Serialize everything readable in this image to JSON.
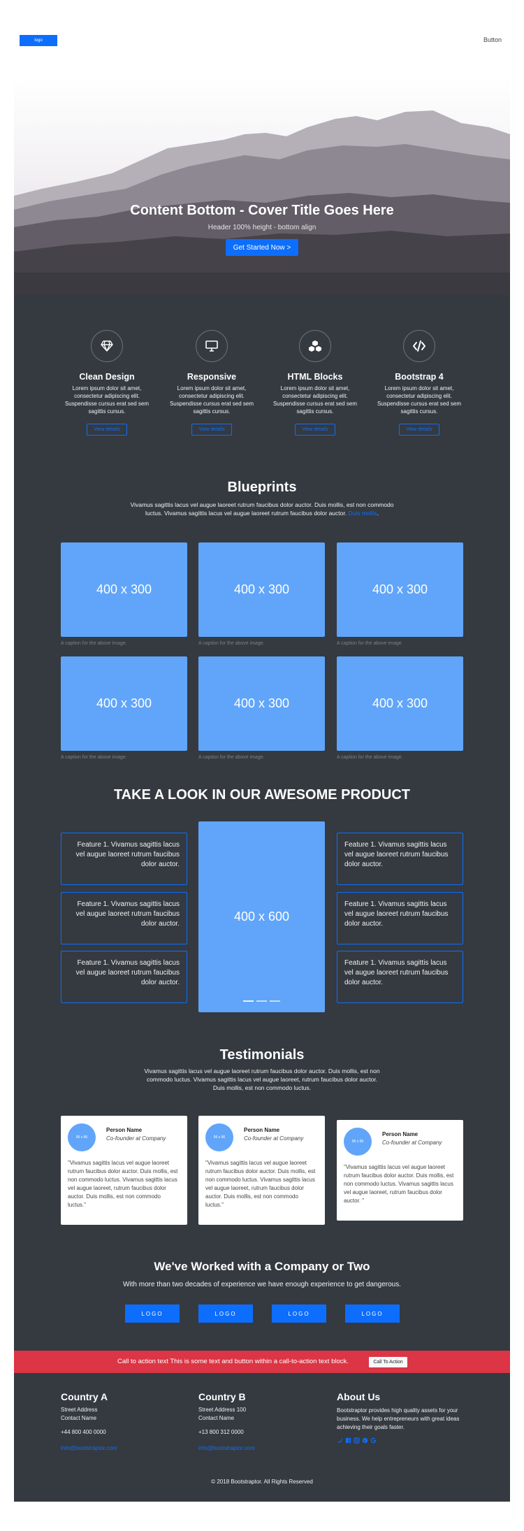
{
  "navbar": {
    "logo": "logo",
    "button": "Button"
  },
  "hero": {
    "title": "Content Bottom - Cover Title Goes Here",
    "subtitle": "Header 100% height - bottom align",
    "cta": "Get Started Now >"
  },
  "features": [
    {
      "icon": "diamond-icon",
      "title": "Clean Design",
      "text": "Lorem ipsum dolor sit amet, consectetur adipiscing elit. Suspendisse cursus erat sed sem sagittis cursus.",
      "button": "View details"
    },
    {
      "icon": "monitor-icon",
      "title": "Responsive",
      "text": "Lorem ipsum dolor sit amet, consectetur adipiscing elit. Suspendisse cursus erat sed sem sagittis cursus.",
      "button": "View details"
    },
    {
      "icon": "cubes-icon",
      "title": "HTML Blocks",
      "text": "Lorem ipsum dolor sit amet, consectetur adipiscing elit. Suspendisse cursus erat sed sem sagittis cursus.",
      "button": "View details"
    },
    {
      "icon": "code-icon",
      "title": "Bootstrap 4",
      "text": "Lorem ipsum dolor sit amet, consectetur adipiscing elit. Suspendisse cursus erat sed sem sagittis cursus.",
      "button": "View details"
    }
  ],
  "blueprints": {
    "title": "Blueprints",
    "text": "Vivamus sagittis lacus vel augue laoreet rutrum faucibus dolor auctor. Duis mollis, est non commodo luctus. Vivamus sagittis lacus vel augue laoreet rutrum faucibus dolor auctor.",
    "link": "Duis mollis",
    "images": [
      {
        "label": "400 x 300",
        "caption": "A caption for the above image."
      },
      {
        "label": "400 x 300",
        "caption": "A caption for the above image."
      },
      {
        "label": "400 x 300",
        "caption": "A caption for the above image."
      },
      {
        "label": "400 x 300",
        "caption": "A caption for the above image."
      },
      {
        "label": "400 x 300",
        "caption": "A caption for the above image."
      },
      {
        "label": "400 x 300",
        "caption": "A caption for the above image."
      }
    ]
  },
  "product": {
    "title": "TAKE A LOOK IN OUR AWESOME PRODUCT",
    "image_label": "400 x 600",
    "feature_text": "Feature 1. Vivamus sagittis lacus vel augue laoreet rutrum faucibus dolor auctor."
  },
  "testimonials": {
    "title": "Testimonials",
    "text": "Vivamus sagittis lacus vel augue laoreet rutrum faucibus dolor auctor. Duis mollis, est non commodo luctus. Vivamus sagittis lacus vel augue laoreet, rutrum faucibus dolor auctor. Duis mollis, est non commodo luctus.",
    "cards": [
      {
        "avatar": "96 x 96",
        "name": "Person Name",
        "role": "Co-founder at Company",
        "quote": "\"Vivamus sagittis lacus vel augue laoreet rutrum faucibus dolor auctor. Duis mollis, est non commodo luctus. Vivamus sagittis lacus vel augue laoreet, rutrum faucibus dolor auctor. Duis mollis, est non commodo luctus.\""
      },
      {
        "avatar": "96 x 96",
        "name": "Person Name",
        "role": "Co-founder at Company",
        "quote": "\"Vivamus sagittis lacus vel augue laoreet rutrum faucibus dolor auctor. Duis mollis, est non commodo luctus. Vivamus sagittis lacus vel augue laoreet, rutrum faucibus dolor auctor. Duis mollis, est non commodo luctus.\""
      },
      {
        "avatar": "96 x 96",
        "name": "Person Name",
        "role": "Co-founder at Company",
        "quote": "\"Vivamus sagittis lacus vel augue laoreet rutrum faucibus dolor auctor. Duis mollis, est non commodo luctus. Vivamus sagittis lacus vel augue laoreet, rutrum faucibus dolor auctor. \""
      }
    ]
  },
  "companies": {
    "title": "We've Worked with a Company or Two",
    "subtitle": "With more than two decades of experience we have enough experience to get dangerous.",
    "logos": [
      "LOGO",
      "LOGO",
      "LOGO",
      "LOGO"
    ]
  },
  "cta": {
    "text": "Call to action text This is some text and button within a call-to-action text block.",
    "button": "Call To Action"
  },
  "footer": {
    "country_a": {
      "title": "Country A",
      "street": "Street Address",
      "contact": "Contact Name",
      "phone": "+44 800 400 0000",
      "email": "info@bootstraptor.com"
    },
    "country_b": {
      "title": "Country B",
      "street": "Street Address 100",
      "contact": "Contact Name",
      "phone": "+13 800 312 0000",
      "email": "info@bootstraptor.com"
    },
    "about": {
      "title": "About Us",
      "text": "Bootstraptor provides high quality assets for your business. We help entrepreneurs with great ideas achieving their goals faster."
    },
    "social": [
      "twitter-icon",
      "facebook-icon",
      "instagram-icon",
      "pinterest-icon",
      "google-icon"
    ],
    "copyright": "© 2018 Bootstraptor. All Rights Reserved"
  },
  "colors": {
    "primary": "#0d6efd",
    "dark": "#343a40",
    "placeholder": "#60a5fa",
    "cta": "#dc3545"
  }
}
